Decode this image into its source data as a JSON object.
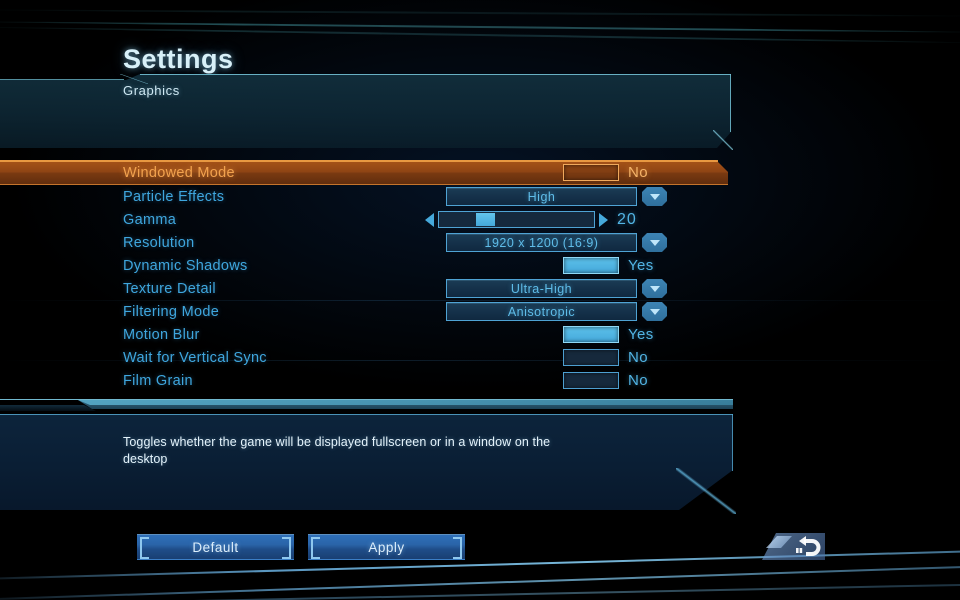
{
  "page": {
    "title": "Settings",
    "section_label": "Graphics"
  },
  "colors": {
    "accent_orange": "#f2a24e",
    "label_blue": "#3fa6de",
    "value_blue": "#52b4e4",
    "title_white": "#d8f0f8",
    "panel_border": "#6ebed2"
  },
  "settings": [
    {
      "label": "Windowed Mode",
      "control": "toggle",
      "value": "No",
      "on": false,
      "selected": true
    },
    {
      "label": "Particle Effects",
      "control": "dropdown",
      "value": "High",
      "selected": false
    },
    {
      "label": "Gamma",
      "control": "slider",
      "value": "20",
      "percent": 24,
      "selected": false
    },
    {
      "label": "Resolution",
      "control": "dropdown",
      "value": "1920 x 1200 (16:9)",
      "selected": false
    },
    {
      "label": "Dynamic Shadows",
      "control": "toggle",
      "value": "Yes",
      "on": true,
      "selected": false
    },
    {
      "label": "Texture Detail",
      "control": "dropdown",
      "value": "Ultra-High",
      "selected": false
    },
    {
      "label": "Filtering Mode",
      "control": "dropdown",
      "value": "Anisotropic",
      "selected": false
    },
    {
      "label": "Motion Blur",
      "control": "toggle",
      "value": "Yes",
      "on": true,
      "selected": false
    },
    {
      "label": "Wait for Vertical Sync",
      "control": "toggle",
      "value": "No",
      "on": false,
      "selected": false
    },
    {
      "label": "Film Grain",
      "control": "toggle",
      "value": "No",
      "on": false,
      "selected": false
    }
  ],
  "description": "Toggles whether the game will be displayed fullscreen or in a window on the desktop",
  "buttons": {
    "default_label": "Default",
    "apply_label": "Apply",
    "back_icon": "back-arrow-icon"
  }
}
